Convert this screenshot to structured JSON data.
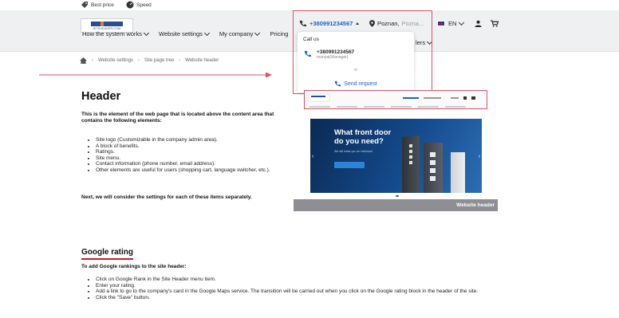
{
  "benefits": [
    {
      "label": "Best price",
      "icon": "tag-icon"
    },
    {
      "label": "Speed",
      "icon": "speedometer-icon"
    }
  ],
  "header": {
    "logo_text": "SITEHEADER.COM",
    "phone": "+380991234567",
    "city": "Poznan,",
    "city_suffix": "Pozna...",
    "language": "EN",
    "menu": [
      {
        "label": "How the system works"
      },
      {
        "label": "Website settings"
      },
      {
        "label": "My company"
      },
      {
        "label": "Pricing"
      }
    ],
    "menu_tail": "lers"
  },
  "dropdown": {
    "title": "Call us",
    "phone": "+380991234567",
    "manager": "manual(Manager)",
    "or": "or",
    "send_request": "Send request"
  },
  "breadcrumb": [
    "Website settings",
    "Site page tree",
    "Website header"
  ],
  "content": {
    "title": "Header",
    "intro": "This is the element of the web page that is located above the content area that contains the following elements:",
    "items": [
      "Site logo (Customizable in the company admin area).",
      "A block of benefits.",
      "Ratings.",
      "Site menu.",
      "Contact information (phone number, email address).",
      "Other elements are useful for users (shopping cart, language switcher, etc.)."
    ],
    "next": "Next, we will consider the settings for each of these items separately."
  },
  "rating_section": {
    "title": "Google rating",
    "intro": "To add Google rankings to the site header:",
    "items": [
      "Click on Google Rank in the Site Header menu item.",
      "Enter your rating.",
      "Add a link to go to the company's card in the Google Maps service. The transition will be carried out when you click on the Google rating block in the header of the site.",
      "Click the \"Save\" button."
    ]
  },
  "preview": {
    "hero_title_line1": "What front door",
    "hero_title_line2": "do you need?",
    "hero_sub": "We will make you an individual",
    "caption": "Website header"
  },
  "colors": {
    "accent_blue": "#1f63c9",
    "highlight_red": "#e0506a",
    "heading_underline": "#c81e2f"
  }
}
